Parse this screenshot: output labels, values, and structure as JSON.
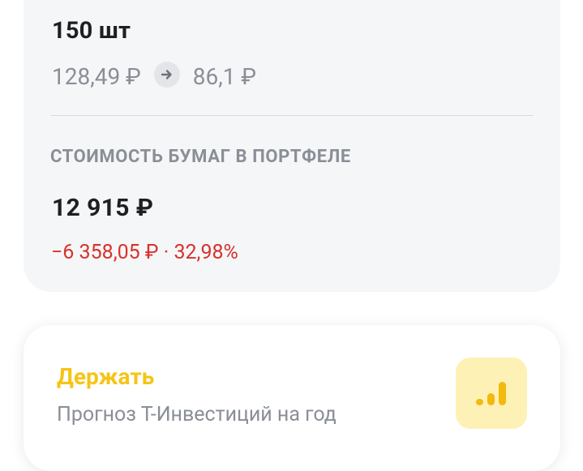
{
  "position": {
    "quantity": "150 шт",
    "price_from": "128,49 ₽",
    "price_to": "86,1 ₽"
  },
  "portfolio": {
    "section_label": "СТОИМОСТЬ БУМАГ В ПОРТФЕЛЕ",
    "total_value": "12 915 ₽",
    "change": "−6 358,05 ₽ · 32,98%"
  },
  "forecast": {
    "title": "Держать",
    "subtitle": "Прогноз Т-Инвестиций на год"
  },
  "icons": {
    "price_arrow": "arrow-right-icon",
    "forecast_signal": "signal-bars-icon"
  },
  "colors": {
    "accent_yellow": "#f7c416",
    "loss_red": "#d8322b",
    "card_gray": "#f5f6f8"
  }
}
